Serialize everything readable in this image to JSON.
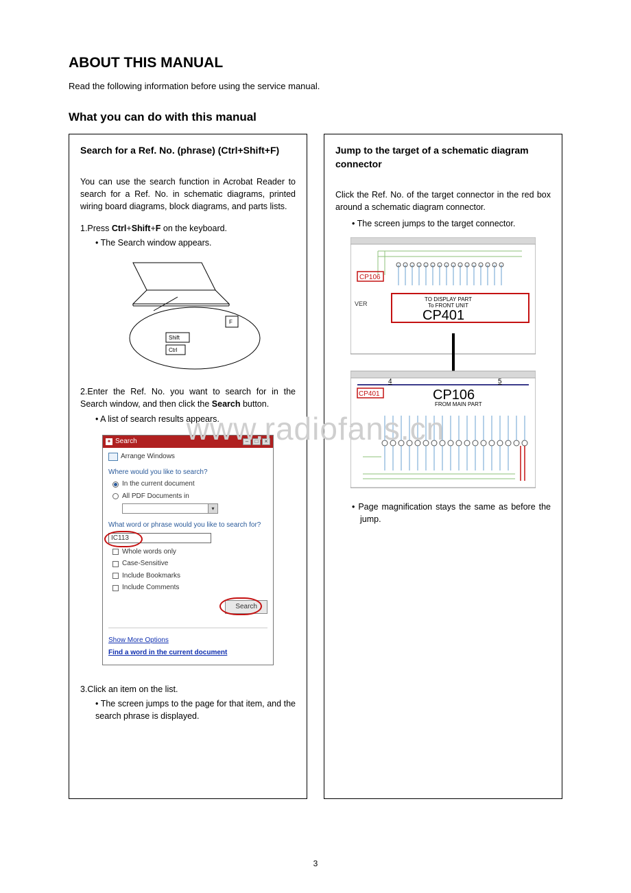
{
  "page": {
    "title": "ABOUT THIS MANUAL",
    "intro": "Read the following information before using the service manual.",
    "section": "What you can do with this manual",
    "number": "3",
    "watermark": "www.radiofans.cn"
  },
  "left": {
    "heading": "Search for a Ref. No. (phrase) (Ctrl+Shift+F)",
    "p1": "You can use the search function in Acrobat Reader to search for a Ref. No. in schematic diagrams, printed wiring board diagrams, block diagrams, and parts lists.",
    "step1_prefix": "1.Press ",
    "step1_key1": "Ctrl",
    "step1_plus": "+",
    "step1_key2": "Shift",
    "step1_key3": "F",
    "step1_suffix": " on the keyboard.",
    "step1_sub": "•  The Search window appears.",
    "keys": {
      "f": "F",
      "shift": "Shift",
      "ctrl": "Ctrl"
    },
    "step2_prefix": "2.Enter the Ref. No. you want to search for in the Search window, and then click the ",
    "step2_bold": "Search",
    "step2_suffix": " button.",
    "step2_sub": "•  A list of search results appears.",
    "search_window": {
      "title": "Search",
      "arrange": "Arrange Windows",
      "where": "Where would you like to search?",
      "opt_current": "In the current document",
      "opt_all": "All PDF Documents in",
      "what": "What word or phrase would you like to search for?",
      "value": "IC113",
      "whole": "Whole words only",
      "case": "Case-Sensitive",
      "bookmarks": "Include Bookmarks",
      "comments": "Include Comments",
      "button": "Search",
      "more": "Show More Options",
      "find": "Find a word in the current document"
    },
    "step3": "3.Click an item on the list.",
    "step3_sub": "•  The screen jumps to the page for that item, and the search phrase is displayed."
  },
  "right": {
    "heading": "Jump to the target of a schematic diagram connector",
    "p1": "Click the Ref. No. of the target connector in the red box around a schematic diagram connector.",
    "b1": "•  The screen jumps to the target connector.",
    "schem": {
      "cp106": "CP106",
      "ver": "VER",
      "to_display": "TO DISPLAY PART",
      "to_front": "To FRONT UNIT",
      "cp401_big": "CP401",
      "cp401_label": "CP401",
      "cp106_big": "CP106",
      "from_main": "FROM MAIN PART",
      "n4": "4",
      "n5": "5"
    },
    "b2": "•  Page magnification stays the same as before the jump."
  }
}
